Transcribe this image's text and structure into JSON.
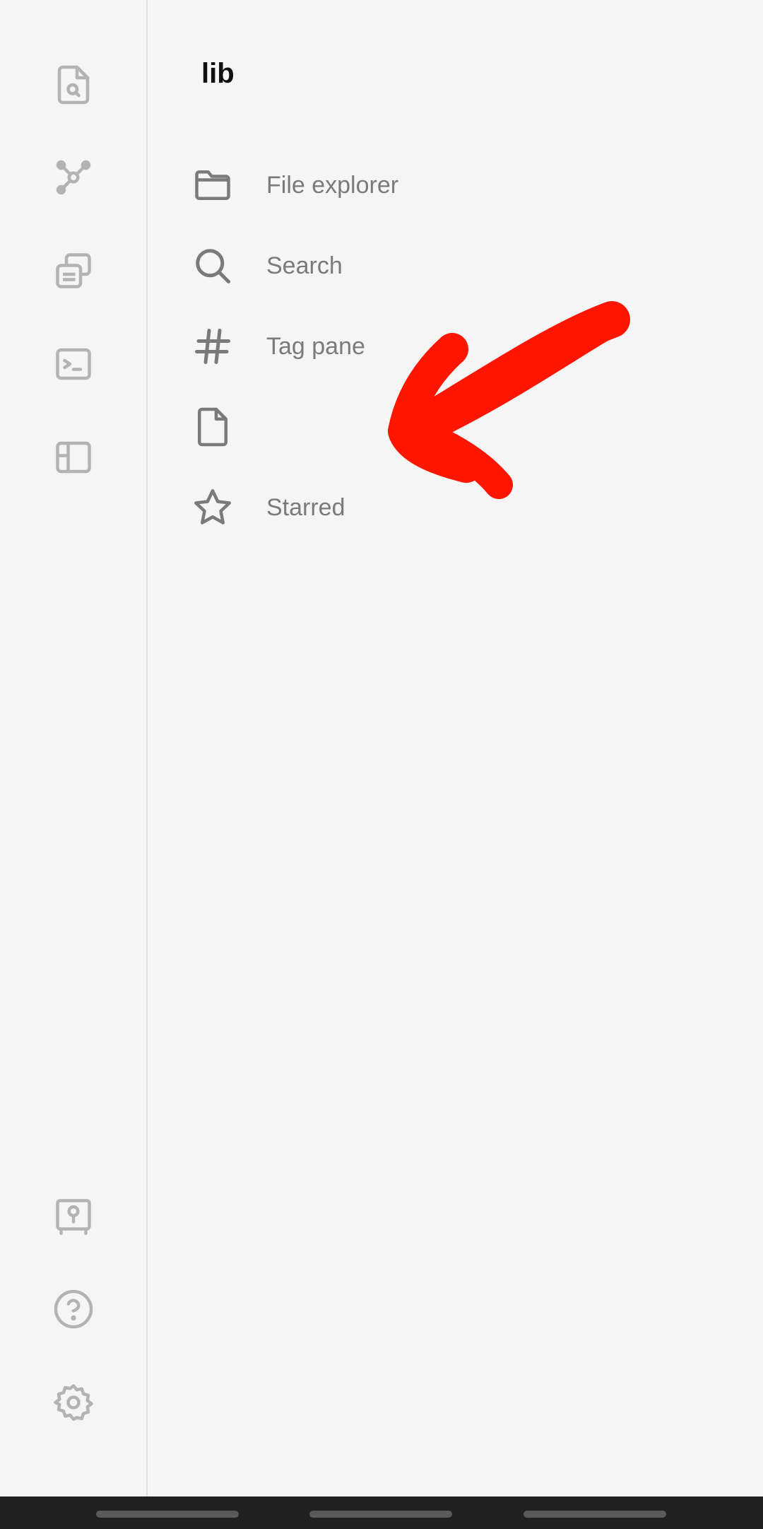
{
  "ribbon": {
    "top_items": [
      {
        "icon": "quick-switcher-icon"
      },
      {
        "icon": "graph-view-icon"
      },
      {
        "icon": "templates-icon"
      },
      {
        "icon": "command-palette-icon"
      },
      {
        "icon": "layout-sidebar-icon"
      }
    ],
    "bottom_items": [
      {
        "icon": "vault-switcher-icon"
      },
      {
        "icon": "help-icon"
      },
      {
        "icon": "settings-icon"
      }
    ]
  },
  "vault": {
    "name": "lib"
  },
  "panes": [
    {
      "label": "File explorer",
      "icon": "folder-icon"
    },
    {
      "label": "Search",
      "icon": "search-icon"
    },
    {
      "label": "Tag pane",
      "icon": "hash-icon"
    },
    {
      "label": "",
      "icon": "file-icon"
    },
    {
      "label": "Starred",
      "icon": "star-icon"
    }
  ],
  "annotation": {
    "color": "#ff1500",
    "kind": "red-arrow"
  }
}
